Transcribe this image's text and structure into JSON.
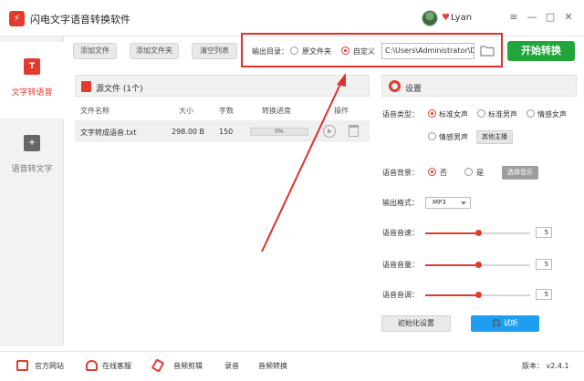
{
  "app": {
    "title": "闪电文字语音转换软件",
    "logo_text": "⚡",
    "username": "Lyan"
  },
  "window_controls": {
    "menu": "≡",
    "minimize": "—",
    "maximize": "□",
    "close": "✕"
  },
  "sidebar": {
    "items": [
      {
        "label": "文字转语音",
        "icon_text": "T",
        "active": true
      },
      {
        "label": "语音转文字",
        "icon_text": "+"
      }
    ]
  },
  "toolbar": {
    "add_file": "添加文件",
    "add_folder": "添加文件夹",
    "clear_list": "清空列表"
  },
  "output": {
    "label": "输出目录：",
    "option_source": "原文件夹",
    "option_custom": "自定义",
    "selected": "custom",
    "path": "C:\\Users\\Administrator\\De",
    "start_button": "开始转换"
  },
  "source": {
    "title": "源文件 (1个)",
    "columns": [
      "文件名称",
      "大小",
      "字数",
      "转换进度",
      "操作"
    ],
    "files": [
      {
        "name": "文字转成语音.txt",
        "size": "298.00 B",
        "chars": "150",
        "progress": "0%"
      }
    ]
  },
  "settings": {
    "title": "设置",
    "voice_type_label": "语音类型：",
    "voice_options": [
      "标准女声",
      "标准男声",
      "情感女声",
      "情感男声"
    ],
    "voice_selected": 0,
    "other_anchor": "其他主播",
    "bg_label": "语音背景：",
    "bg_options": [
      "否",
      "是"
    ],
    "bg_selected": 0,
    "choose_music": "选择音乐",
    "format_label": "输出格式：",
    "format_value": "MP3",
    "speed_label": "语音音速：",
    "speed_value": "5",
    "speed_fraction": 0.5,
    "volume_label": "语音音量：",
    "volume_value": "5",
    "volume_fraction": 0.5,
    "pitch_label": "语音音调：",
    "pitch_value": "5",
    "pitch_fraction": 0.5,
    "reset_button": "初始化设置",
    "listen_button": "试听"
  },
  "footer": {
    "website": "官方网站",
    "support": "在线客服",
    "audio_edit": "音频剪辑",
    "record": "录音",
    "audio_convert": "音频转换",
    "version": "版本： v2.4.1"
  },
  "colors": {
    "accent": "#e23b2e",
    "start": "#21a63b",
    "listen": "#1e9ef0"
  }
}
